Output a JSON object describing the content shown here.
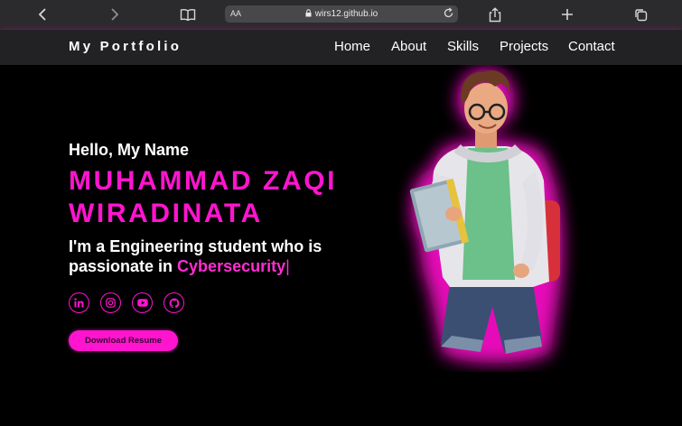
{
  "browser": {
    "url": "wirs12.github.io",
    "text_size_label": "AA",
    "icons": [
      "back-icon",
      "forward-icon",
      "book-icon",
      "lock-icon",
      "reload-icon",
      "share-icon",
      "plus-icon",
      "tabs-icon"
    ]
  },
  "navbar": {
    "logo": "My Portfolio",
    "links": [
      "Home",
      "About",
      "Skills",
      "Projects",
      "Contact"
    ]
  },
  "hero": {
    "greeting": "Hello, My Name",
    "name_line1": "MUHAMMAD ZAQI",
    "name_line2": "WIRADINATA",
    "tagline_prefix": "I'm a Engineering student who is passionate in ",
    "tagline_highlight": "Cybersecurity",
    "cursor": "|",
    "socials": [
      "linkedin-icon",
      "instagram-icon",
      "youtube-icon",
      "github-icon"
    ],
    "resume_button": "Download Resume"
  },
  "colors": {
    "accent": "#ff14cf",
    "navbar_bg": "#222224",
    "browser_bg": "#2b2b2d",
    "page_bg": "#000000"
  }
}
